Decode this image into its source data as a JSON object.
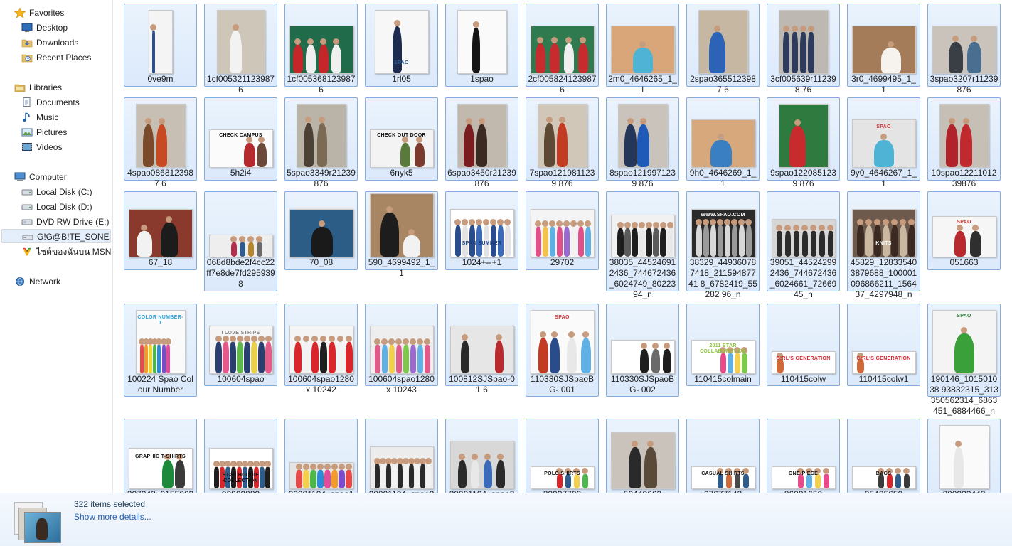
{
  "nav": {
    "favorites": [
      {
        "label": "Favorites",
        "icon": "star-icon",
        "level": 0
      },
      {
        "label": "Desktop",
        "icon": "desktop-icon",
        "level": 1
      },
      {
        "label": "Downloads",
        "icon": "downloads-folder-icon",
        "level": 1
      },
      {
        "label": "Recent Places",
        "icon": "recent-places-icon",
        "level": 1
      }
    ],
    "libraries": [
      {
        "label": "Libraries",
        "icon": "libraries-icon",
        "level": 0
      },
      {
        "label": "Documents",
        "icon": "documents-icon",
        "level": 1
      },
      {
        "label": "Music",
        "icon": "music-icon",
        "level": 1
      },
      {
        "label": "Pictures",
        "icon": "pictures-icon",
        "level": 1
      },
      {
        "label": "Videos",
        "icon": "videos-icon",
        "level": 1
      }
    ],
    "computer": [
      {
        "label": "Computer",
        "icon": "computer-icon",
        "level": 0
      },
      {
        "label": "Local Disk (C:)",
        "icon": "local-disk-icon",
        "level": 1
      },
      {
        "label": "Local Disk (D:)",
        "icon": "local-disk-icon",
        "level": 1
      },
      {
        "label": "DVD RW Drive (E:) M",
        "icon": "dvd-drive-icon",
        "level": 1
      },
      {
        "label": "G!G@B!TE_SONE (J:)",
        "icon": "removable-drive-icon",
        "level": 1,
        "selected": true
      },
      {
        "label": "ไซต์ของฉันบน MSN",
        "icon": "msn-icon",
        "level": 1
      }
    ],
    "network": [
      {
        "label": "Network",
        "icon": "network-icon",
        "level": 0
      }
    ]
  },
  "files": [
    [
      "0ve9m",
      "1cf005321123987 6",
      "1cf005368123987 6",
      "1rl05",
      "1spao",
      "2cf005824123987 6",
      "2m0_4646265_1_1",
      "2spao3655123987 6",
      "3cf005639r112398 76",
      "3r0_4699495_1_1",
      "3spao3207r11239 876"
    ],
    [
      "4spao0868123987 6",
      "5h2i4",
      "5spao3349r21239 876",
      "6nyk5",
      "6spao3450r21239 876",
      "7spao1219811239 876",
      "8spao1219971239 876",
      "9h0_4646269_1_1",
      "9spao1220851239 876",
      "9y0_4646267_1_1",
      "10spao1221101239876"
    ],
    [
      "67_18",
      "068d8bde2f4cc22ff7e8de7fd2959398",
      "70_08",
      "590_4699492_1_1",
      "1024+--+1",
      "29702",
      "38035_445246912436_744672436_6024749_8022394_n",
      "38329_449360787418_21159487741 8_6782419_55282 96_n",
      "39051_445242992436_744672436_6024661_7266945_n",
      "45829_128335403879688_100001096866211_156437_4297948_n",
      "051663"
    ],
    [
      "100224 Spao Colour Number",
      "100604spao",
      "100604spao1280x 10242",
      "100604spao1280x 10243",
      "100812SJSpao-01 6",
      "110330SJSpaoBG- 001",
      "110330SJSpaoBG- 002",
      "110415colmain",
      "110415colw",
      "110415colw1",
      "190146_101501038 93832315_313350562314_6863451_6884466_n"
    ],
    [
      "207243_21550630",
      "02909989",
      "20091104_spao1",
      "20091104_spao2",
      "20091104_spao3",
      "29937702",
      "50449663",
      "67677143",
      "86081650",
      "95425650",
      "200923443"
    ]
  ],
  "thumb_text": {
    "check_campus": "CHECK CAMPUS",
    "check_out_door": "CHECK OUT DOOR",
    "spao": "SPAO",
    "spao_summer": "SPAO SUMMER",
    "www_spao": "WWW.SPAO.COM",
    "knits": "KNITS",
    "color_number": "COLOR NUMBER-T",
    "love_stripe": "I LOVE STRIPE",
    "star_2011": "2011 STAR COLLABORATION",
    "girls_generation": "GIRL'S GENERATION",
    "graphic_tshirts": "GRAPHIC T-SHIRTS",
    "star_hoodie": "STAR HOODIE COLLECTION",
    "polo_shirts": "POLO SHIRTS",
    "casual_shirts": "CASUAL SHIRTS",
    "one_piece": "ONE-PIECE",
    "bags": "BAGS"
  },
  "details": {
    "selected_count": "322 items selected",
    "show_more": "Show more details..."
  },
  "colors": {
    "tile_bg": "#dbe9fb",
    "tile_border": "#84acdd",
    "link": "#2665b5",
    "nav_selected": "#e5eefb"
  }
}
